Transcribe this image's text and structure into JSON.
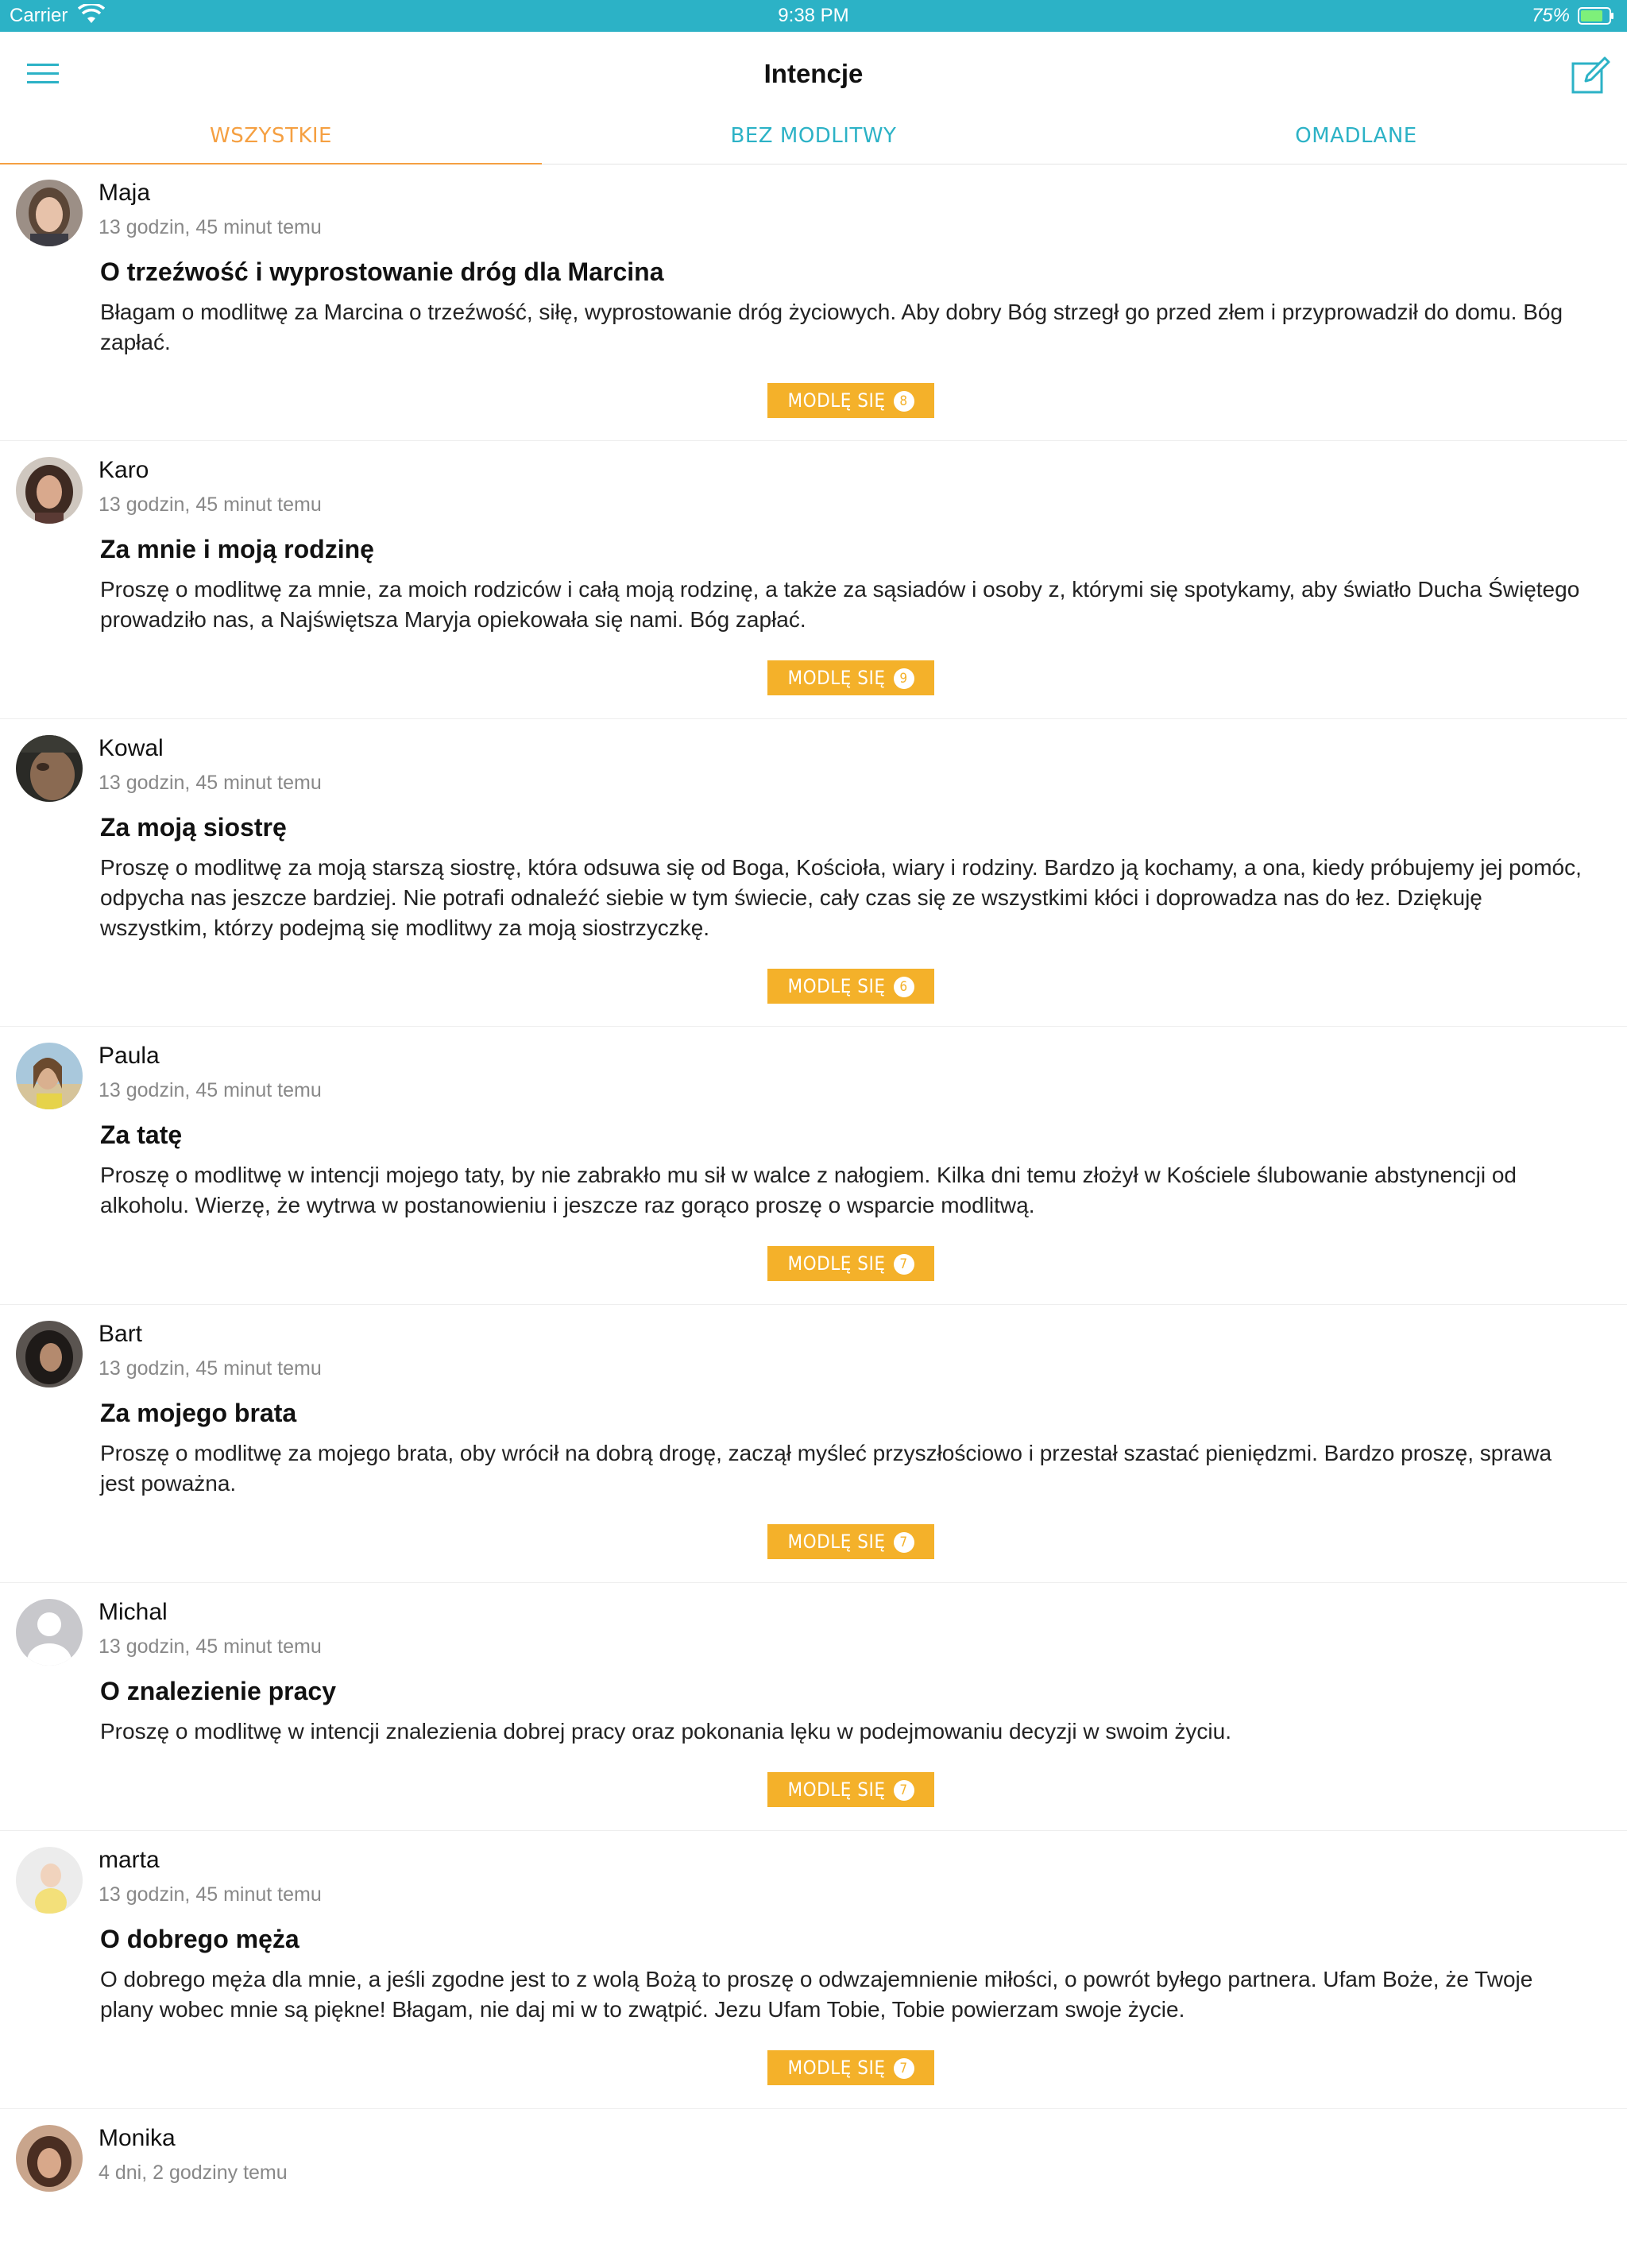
{
  "status_bar": {
    "carrier": "Carrier",
    "time": "9:38 PM",
    "battery": "75%"
  },
  "nav": {
    "title": "Intencje",
    "menu_icon": "hamburger-menu-icon",
    "compose_icon": "compose-edit-icon"
  },
  "tabs": [
    {
      "label": "WSZYSTKIE",
      "active": true
    },
    {
      "label": "BEZ MODLITWY",
      "active": false
    },
    {
      "label": "OMADLANE",
      "active": false
    }
  ],
  "colors": {
    "accent_teal": "#2cb2c6",
    "accent_orange": "#f5a042",
    "button_yellow": "#f4b12a"
  },
  "pray_label": "MODLĘ SIĘ",
  "intentions": [
    {
      "author": "Maja",
      "time": "13 godzin, 45 minut temu",
      "title": "O trzeźwość i wyprostowanie dróg dla Marcina",
      "body": "Błagam o modlitwę za Marcina o trzeźwość, siłę, wyprostowanie dróg życiowych. Aby dobry Bóg strzegł go przed złem i przyprowadził do domu. Bóg zapłać.",
      "count": "8"
    },
    {
      "author": "Karo",
      "time": "13 godzin, 45 minut temu",
      "title": "Za mnie i moją rodzinę",
      "body": "Proszę o modlitwę za mnie, za moich rodziców i całą moją rodzinę, a także za sąsiadów i osoby z, którymi się spotykamy, aby światło Ducha Świętego prowadziło nas, a Najświętsza Maryja opiekowała się nami. Bóg zapłać.",
      "count": "9"
    },
    {
      "author": "Kowal",
      "time": "13 godzin, 45 minut temu",
      "title": "Za moją siostrę",
      "body": "Proszę o modlitwę za moją starszą siostrę, która odsuwa się od Boga, Kościoła, wiary i rodziny. Bardzo ją kochamy, a ona, kiedy próbujemy jej pomóc, odpycha nas jeszcze bardziej. Nie potrafi odnaleźć siebie w tym świecie, cały czas się ze wszystkimi kłóci i doprowadza nas do łez. Dziękuję wszystkim, którzy podejmą się modlitwy za moją siostrzyczkę.",
      "count": "6"
    },
    {
      "author": "Paula",
      "time": "13 godzin, 45 minut temu",
      "title": "Za tatę",
      "body": "Proszę o modlitwę w intencji mojego taty, by nie zabrakło mu sił w walce z nałogiem. Kilka dni temu złożył w Kościele ślubowanie abstynencji od alkoholu. Wierzę, że wytrwa w postanowieniu i jeszcze raz gorąco proszę o wsparcie modlitwą.",
      "count": "7"
    },
    {
      "author": "Bart",
      "time": "13 godzin, 45 minut temu",
      "title": "Za mojego brata",
      "body": "Proszę o modlitwę za mojego brata, oby wrócił na dobrą drogę, zaczął myśleć przyszłościowo i przestał szastać pieniędzmi. Bardzo proszę, sprawa jest poważna.",
      "count": "7"
    },
    {
      "author": "Michal",
      "time": "13 godzin, 45 minut temu",
      "title": "O znalezienie pracy",
      "body": "Proszę o modlitwę w intencji znalezienia dobrej pracy oraz pokonania lęku w podejmowaniu decyzji w swoim życiu.",
      "count": "7"
    },
    {
      "author": "marta",
      "time": "13 godzin, 45 minut temu",
      "title": "O dobrego męża",
      "body": "O dobrego męża dla mnie, a jeśli zgodne jest to z wolą Bożą to proszę o odwzajemnienie miłości, o powrót byłego partnera. Ufam Boże, że Twoje plany wobec mnie są piękne! Błagam, nie daj mi w to zwątpić. Jezu Ufam Tobie, Tobie powierzam swoje życie.",
      "count": "7"
    },
    {
      "author": "Monika",
      "time": "4 dni, 2 godziny temu"
    }
  ]
}
